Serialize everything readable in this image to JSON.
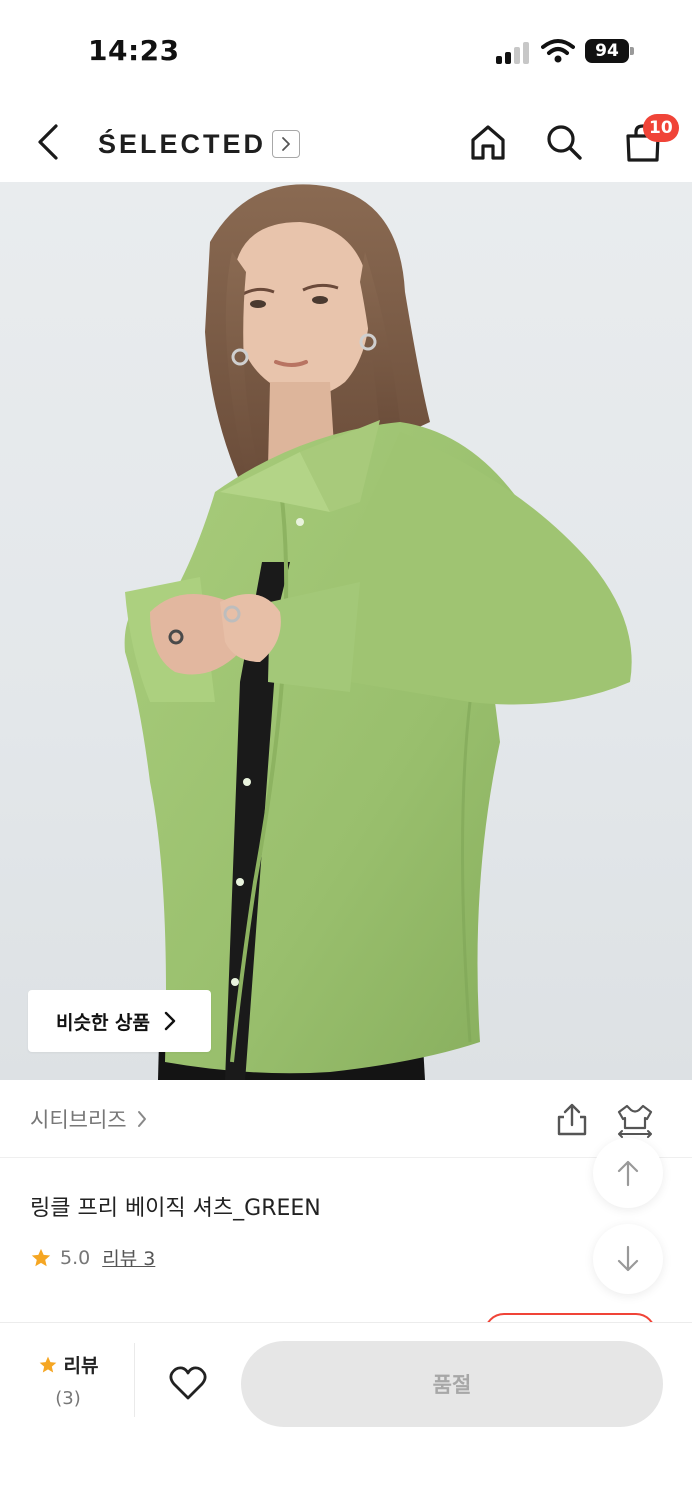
{
  "status_bar": {
    "time": "14:23",
    "battery": "94"
  },
  "header": {
    "brand": "ŚELECTED",
    "cart_count": "10",
    "icons": [
      "back-icon",
      "chevron-right-icon",
      "home-icon",
      "search-icon",
      "shopping-bag-icon"
    ]
  },
  "gallery": {
    "similar_button_label": "비슷한 상품"
  },
  "store": {
    "name": "시티브리즈"
  },
  "product": {
    "title": "링클 프리 베이직 셔츠_GREEN",
    "rating": "5.0",
    "review_link": "리뷰 3"
  },
  "bottom_bar": {
    "review_label": "리뷰",
    "review_count": "(3)",
    "soldout_label": "품절"
  },
  "colors": {
    "accent_red": "#f04438",
    "star": "#f5a623",
    "shirt_green": "#9cc271",
    "soldout_bg": "#e6e6e6"
  }
}
